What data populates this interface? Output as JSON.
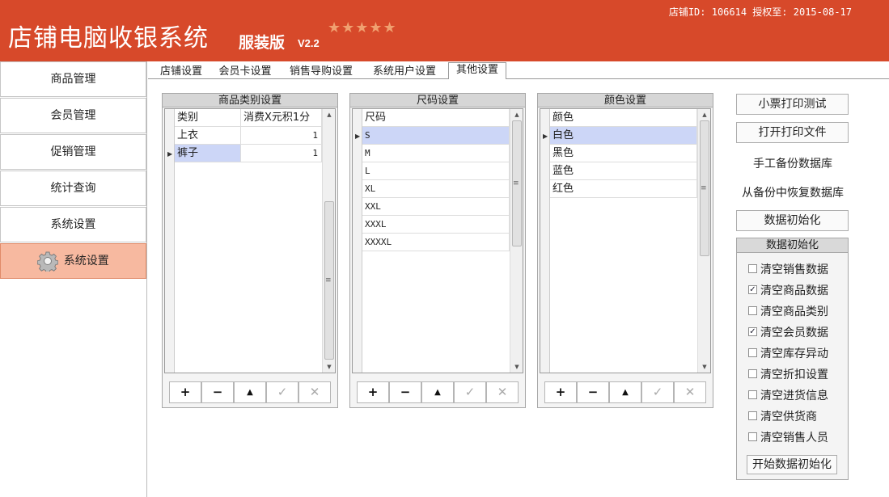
{
  "header": {
    "title": "店铺电脑收银系统",
    "edition": "服装版",
    "version": "V2.2",
    "stars": "★★★★★",
    "store_info": "店铺ID: 106614 授权至: 2015-08-17"
  },
  "sidebar": {
    "items": [
      {
        "label": "商品管理"
      },
      {
        "label": "会员管理"
      },
      {
        "label": "促销管理"
      },
      {
        "label": "统计查询"
      },
      {
        "label": "系统设置"
      },
      {
        "label": "系统设置",
        "active": true,
        "icon": "gear-icon"
      }
    ]
  },
  "tabs": [
    {
      "label": "店铺设置"
    },
    {
      "label": "会员卡设置"
    },
    {
      "label": "销售导购设置"
    },
    {
      "label": "系统用户设置"
    },
    {
      "label": "其他设置",
      "active": true
    }
  ],
  "category_panel": {
    "title": "商品类别设置",
    "columns": [
      "类别",
      "消费X元积1分"
    ],
    "rows": [
      {
        "name": "上衣",
        "points": "1"
      },
      {
        "name": "裤子",
        "points": "1",
        "selected": true
      }
    ]
  },
  "size_panel": {
    "title": "尺码设置",
    "columns": [
      "尺码"
    ],
    "rows": [
      "S",
      "M",
      "L",
      "XL",
      "XXL",
      "XXXL",
      "XXXXL"
    ]
  },
  "color_panel": {
    "title": "颜色设置",
    "columns": [
      "颜色"
    ],
    "rows": [
      "白色",
      "黑色",
      "蓝色",
      "红色"
    ]
  },
  "toolbar_icons": {
    "add": "+",
    "remove": "−",
    "move_up": "▲",
    "confirm": "✓",
    "cancel": "✕"
  },
  "right": {
    "print_test": "小票打印测试",
    "open_print_file": "打开打印文件",
    "manual_backup": "手工备份数据库",
    "restore_backup": "从备份中恢复数据库",
    "init_data": "数据初始化",
    "group_title": "数据初始化",
    "checkboxes": [
      {
        "label": "清空销售数据",
        "checked": false
      },
      {
        "label": "清空商品数据",
        "checked": true
      },
      {
        "label": "清空商品类别",
        "checked": false
      },
      {
        "label": "清空会员数据",
        "checked": true
      },
      {
        "label": "清空库存异动",
        "checked": false
      },
      {
        "label": "清空折扣设置",
        "checked": false
      },
      {
        "label": "清空进货信息",
        "checked": false
      },
      {
        "label": "清空供货商",
        "checked": false
      },
      {
        "label": "清空销售人员",
        "checked": false
      }
    ],
    "start_init": "开始数据初始化"
  },
  "colors": {
    "header_bg": "#d7492a",
    "active_nav_bg": "#f7b9a0",
    "selected_row_bg": "#ccd6f7"
  }
}
